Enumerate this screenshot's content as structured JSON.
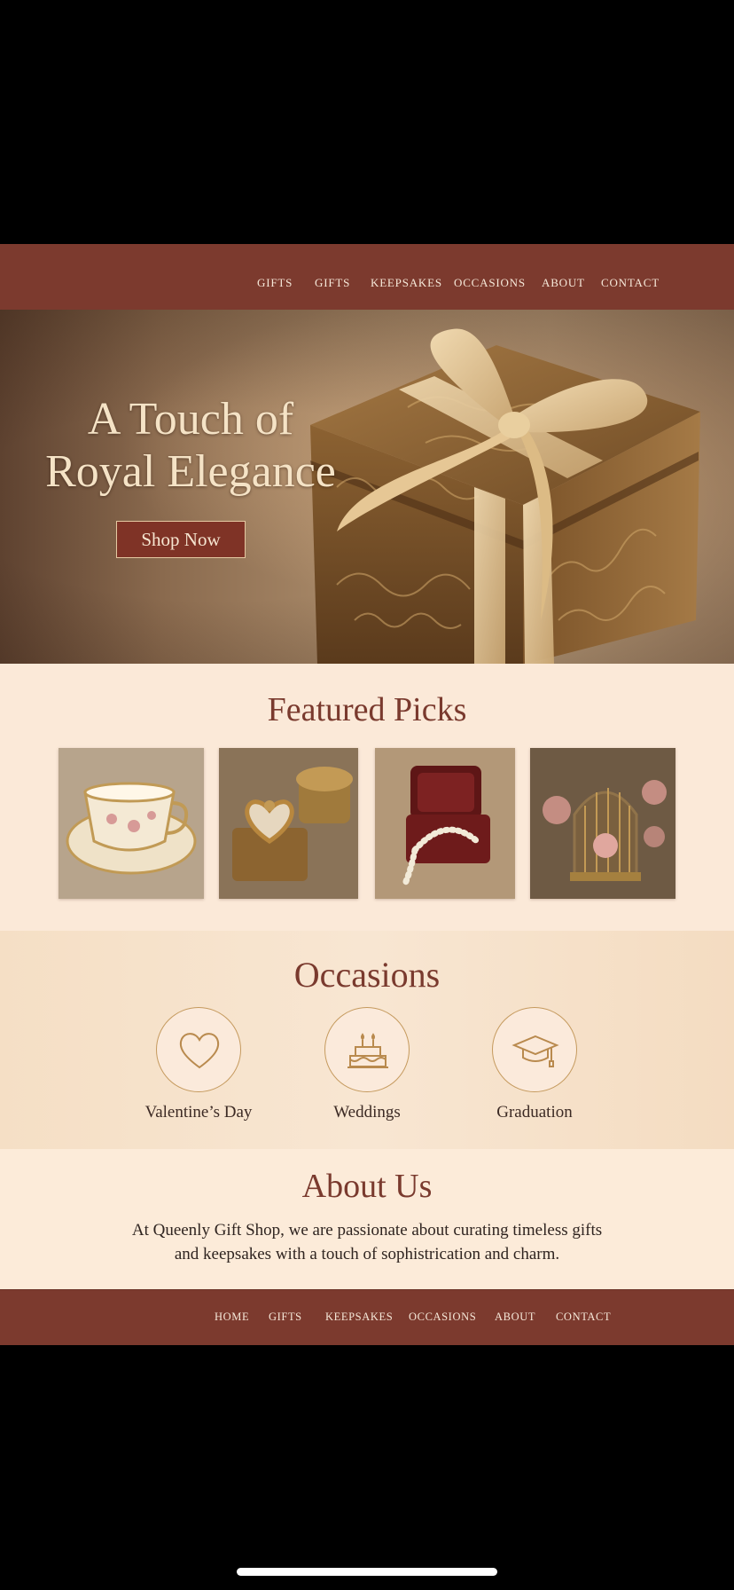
{
  "header": {
    "nav": [
      "GIFTS",
      "GIFTS",
      "KEEPSAKES",
      "OCCASIONS",
      "ABOUT",
      "CONTACT"
    ]
  },
  "hero": {
    "title_line1": "A Touch of",
    "title_line2": "Royal Elegance",
    "cta_label": "Shop Now",
    "image": "ornate-gift-box-with-ribbon"
  },
  "featured": {
    "title": "Featured Picks",
    "items": [
      {
        "image": "floral-teacup-and-saucer"
      },
      {
        "image": "heart-trinket-boxes"
      },
      {
        "image": "pearl-necklace-in-velvet-box"
      },
      {
        "image": "gilded-birdcage-with-roses"
      }
    ]
  },
  "occasions": {
    "title": "Occasions",
    "items": [
      {
        "label": "Valentine’s Day",
        "icon": "heart-icon"
      },
      {
        "label": "Weddings",
        "icon": "cake-icon"
      },
      {
        "label": "Graduation",
        "icon": "graduation-cap-icon"
      }
    ]
  },
  "about": {
    "title": "About Us",
    "text_line1": "At Queenly Gift Shop, we are passionate about curating timeless gifts",
    "text_line2": "and keepsakes with a touch of sophistrication and charm."
  },
  "footer": {
    "nav": [
      "HOME",
      "GIFTS",
      "KEEPSAKES",
      "OCCASIONS",
      "ABOUT",
      "CONTACT"
    ]
  },
  "colors": {
    "primary": "#7c3a2e",
    "cream": "#fbe9d8",
    "gold": "#c59a5e",
    "text": "#3c2a24"
  }
}
